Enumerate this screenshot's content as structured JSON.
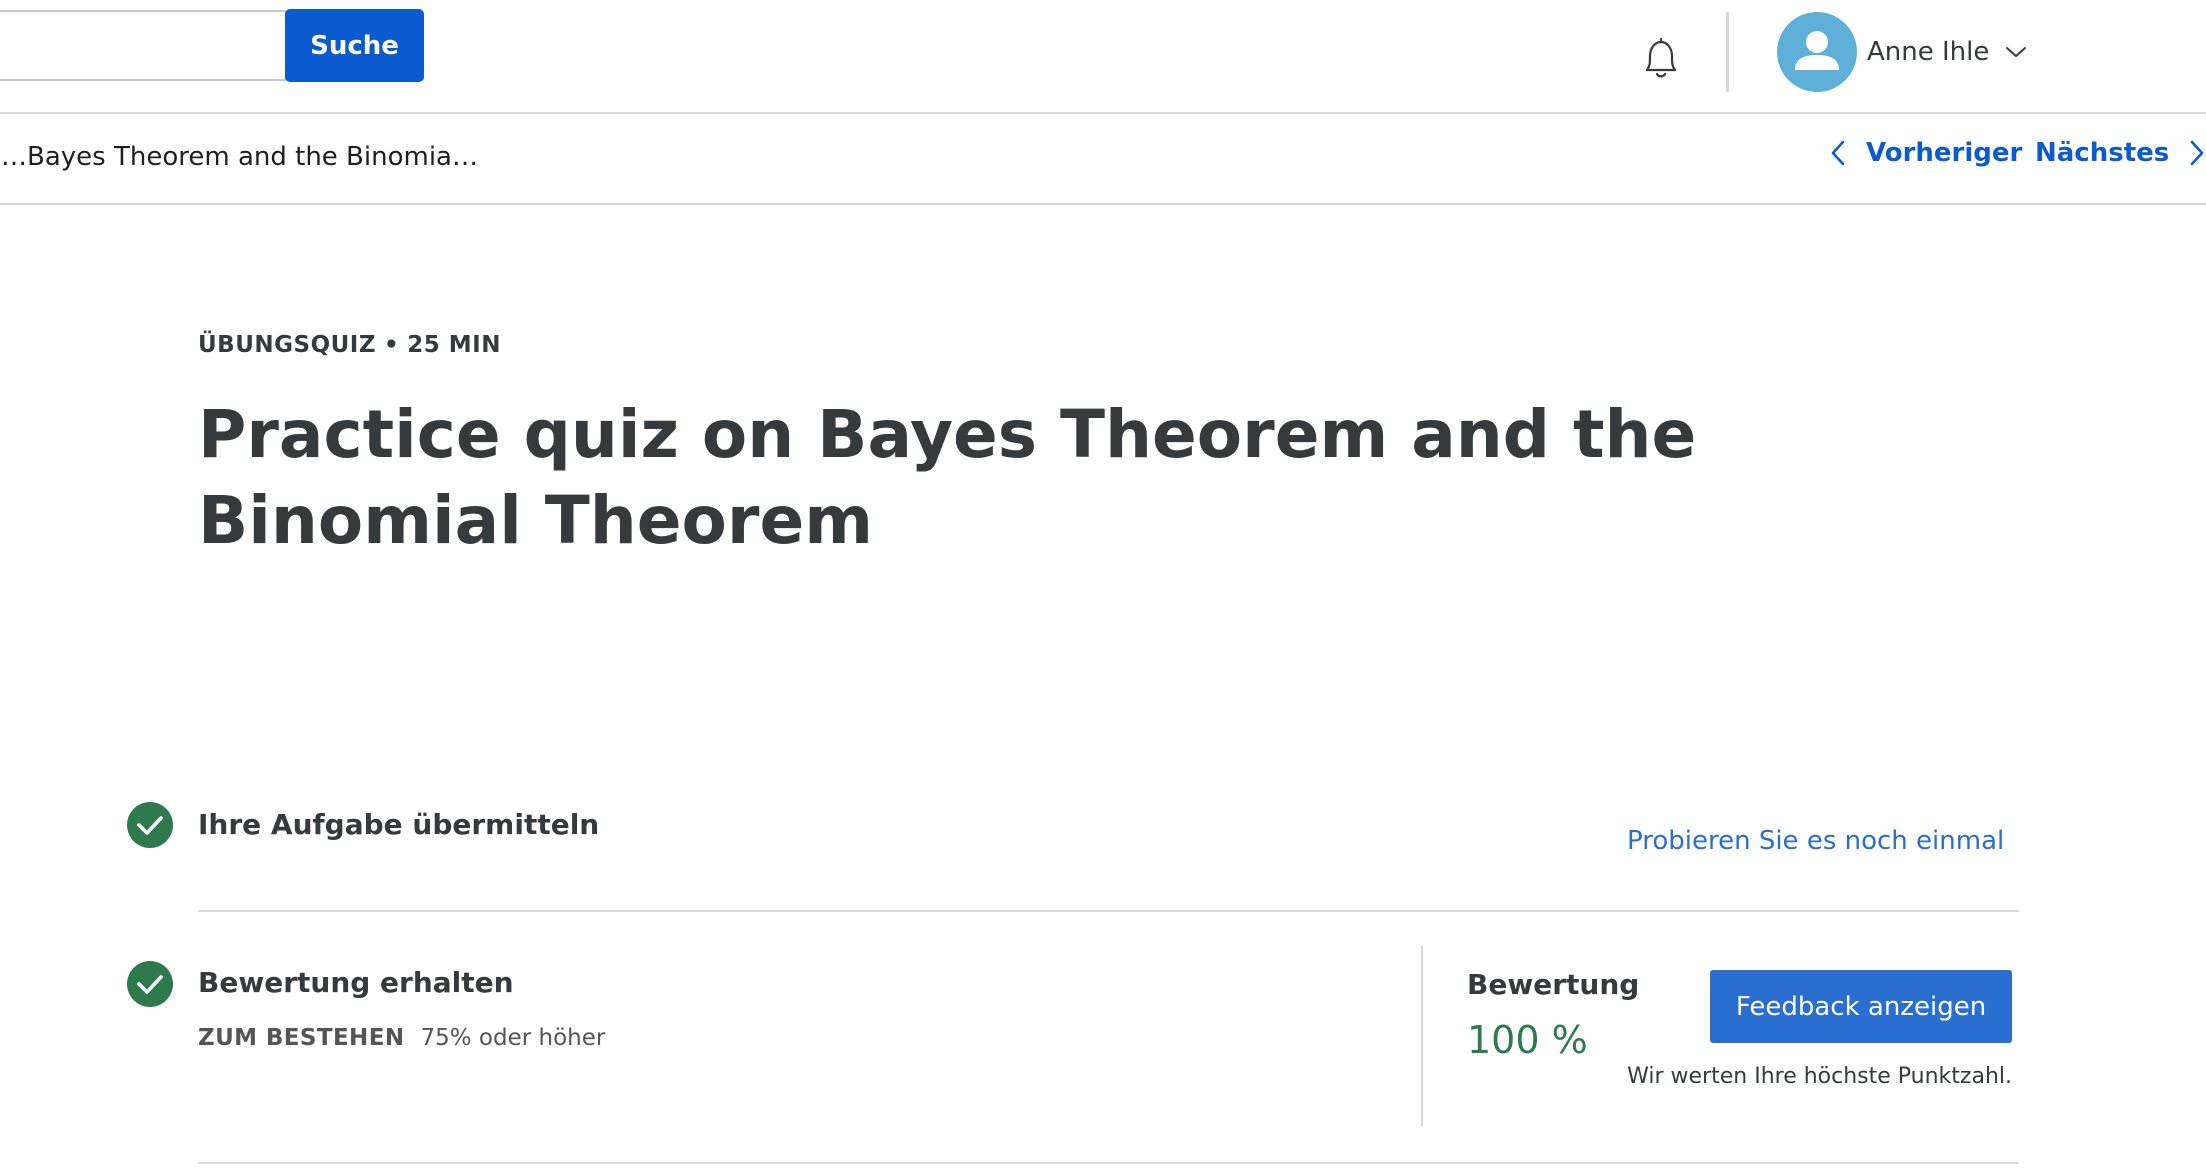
{
  "header": {
    "search": {
      "value": "",
      "placeholder": "",
      "button_label": "Suche"
    },
    "user": {
      "name": "Anne Ihle"
    },
    "icons": {
      "notifications": "bell-icon",
      "avatar": "user-silhouette-icon",
      "user_menu": "chevron-down-icon"
    }
  },
  "nav": {
    "breadcrumb": "Practice quiz on Bayes Theorem and the Binomia…",
    "previous_label": "Vorheriger",
    "next_label": "Nächstes"
  },
  "main": {
    "kicker_type": "ÜBUNGSQUIZ",
    "kicker_separator": "•",
    "kicker_duration": "25 MIN",
    "title": "Practice quiz on Bayes Theorem and the Binomial Theorem",
    "steps": [
      {
        "title": "Ihre Aufgabe übermitteln",
        "status": "completed",
        "action_label": "Probieren Sie es noch einmal"
      },
      {
        "title": "Bewertung erhalten",
        "status": "completed",
        "pass_label": "ZUM BESTEHEN",
        "pass_value": "75% oder höher"
      }
    ],
    "grade": {
      "label": "Bewertung",
      "value": "100 %",
      "button_label": "Feedback anzeigen",
      "note": "Wir werten Ihre höchste Punktzahl."
    }
  },
  "colors": {
    "primary_blue": "#0b5bd0",
    "link_blue": "#2a6fd0",
    "success_green": "#2f7a4c",
    "avatar_blue": "#5eb0d9",
    "text_dark": "#373a3c",
    "divider": "#d6d6d6"
  }
}
